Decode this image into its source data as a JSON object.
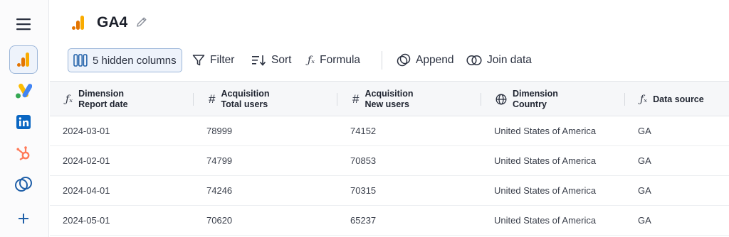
{
  "app": {
    "title": "GA4",
    "accent": "#9cb6d9",
    "logo_colors": [
      "#f9ab00",
      "#e37400"
    ]
  },
  "sidebar": {
    "items": [
      {
        "name": "menu-icon"
      },
      {
        "name": "google-analytics-icon",
        "active": true
      },
      {
        "name": "google-ads-icon"
      },
      {
        "name": "linkedin-icon"
      },
      {
        "name": "hubspot-icon"
      },
      {
        "name": "link-icon"
      },
      {
        "name": "plus-icon"
      }
    ]
  },
  "toolbar": {
    "hidden_columns_label": "5 hidden columns",
    "filter_label": "Filter",
    "sort_label": "Sort",
    "formula_label": "Formula",
    "append_label": "Append",
    "join_label": "Join data"
  },
  "table": {
    "columns": [
      {
        "icon": "fx",
        "line1": "Dimension",
        "line2": "Report date"
      },
      {
        "icon": "#",
        "line1": "Acquisition",
        "line2": "Total users"
      },
      {
        "icon": "#",
        "line1": "Acquisition",
        "line2": "New users"
      },
      {
        "icon": "globe",
        "line1": "Dimension",
        "line2": "Country"
      },
      {
        "icon": "fx",
        "line1": "Data source",
        "line2": ""
      }
    ],
    "rows": [
      [
        "2024-03-01",
        "78999",
        "74152",
        "United States of America",
        "GA"
      ],
      [
        "2024-02-01",
        "74799",
        "70853",
        "United States of America",
        "GA"
      ],
      [
        "2024-04-01",
        "74246",
        "70315",
        "United States of America",
        "GA"
      ],
      [
        "2024-05-01",
        "70620",
        "65237",
        "United States of America",
        "GA"
      ]
    ]
  }
}
